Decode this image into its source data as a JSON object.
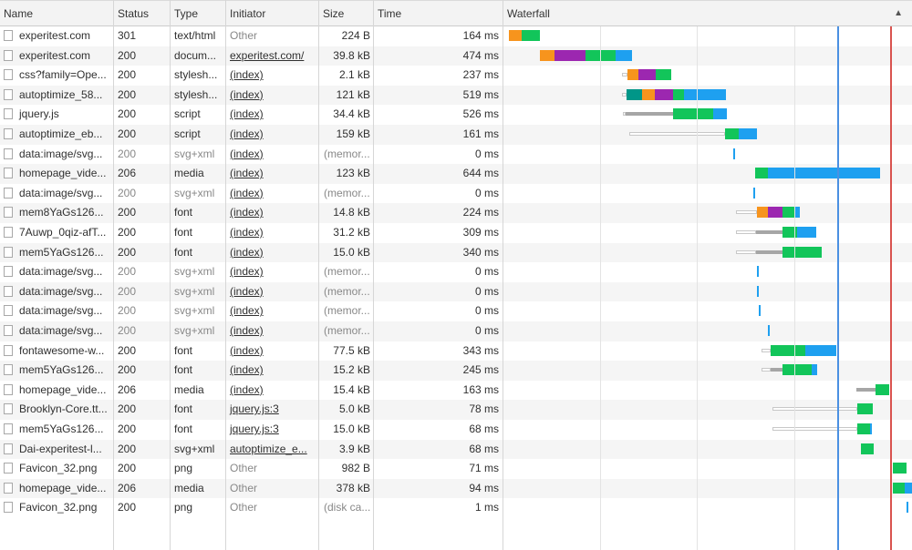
{
  "columns": {
    "name": "Name",
    "status": "Status",
    "type": "Type",
    "initiator": "Initiator",
    "size": "Size",
    "time": "Time",
    "waterfall": "Waterfall"
  },
  "sort_icon": "triangle-up-icon",
  "colors": {
    "dns": "#f7941d",
    "connect": "#9c27b0",
    "ssl": "#009688",
    "waiting": "#12c55a",
    "download": "#1ea0f0",
    "dom_content_loaded_line": "#4a90e2",
    "load_line": "#d9534f"
  },
  "rows": [
    {
      "name": "experitest.com",
      "status": "301",
      "type": "text/html",
      "initiator": "Other",
      "size": "224 B",
      "time": "164 ms"
    },
    {
      "name": "experitest.com",
      "status": "200",
      "type": "docum...",
      "initiator": "experitest.com/",
      "size": "39.8 kB",
      "time": "474 ms"
    },
    {
      "name": "css?family=Ope...",
      "status": "200",
      "type": "stylesh...",
      "initiator": "(index)",
      "size": "2.1 kB",
      "time": "237 ms"
    },
    {
      "name": "autoptimize_58...",
      "status": "200",
      "type": "stylesh...",
      "initiator": "(index)",
      "size": "121 kB",
      "time": "519 ms"
    },
    {
      "name": "jquery.js",
      "status": "200",
      "type": "script",
      "initiator": "(index)",
      "size": "34.4 kB",
      "time": "526 ms"
    },
    {
      "name": "autoptimize_eb...",
      "status": "200",
      "type": "script",
      "initiator": "(index)",
      "size": "159 kB",
      "time": "161 ms"
    },
    {
      "name": "data:image/svg...",
      "status": "200",
      "type": "svg+xml",
      "initiator": "(index)",
      "size": "(memor...",
      "time": "0 ms"
    },
    {
      "name": "homepage_vide...",
      "status": "206",
      "type": "media",
      "initiator": "(index)",
      "size": "123 kB",
      "time": "644 ms"
    },
    {
      "name": "data:image/svg...",
      "status": "200",
      "type": "svg+xml",
      "initiator": "(index)",
      "size": "(memor...",
      "time": "0 ms"
    },
    {
      "name": "mem8YaGs126...",
      "status": "200",
      "type": "font",
      "initiator": "(index)",
      "size": "14.8 kB",
      "time": "224 ms"
    },
    {
      "name": "7Auwp_0qiz-afT...",
      "status": "200",
      "type": "font",
      "initiator": "(index)",
      "size": "31.2 kB",
      "time": "309 ms"
    },
    {
      "name": "mem5YaGs126...",
      "status": "200",
      "type": "font",
      "initiator": "(index)",
      "size": "15.0 kB",
      "time": "340 ms"
    },
    {
      "name": "data:image/svg...",
      "status": "200",
      "type": "svg+xml",
      "initiator": "(index)",
      "size": "(memor...",
      "time": "0 ms"
    },
    {
      "name": "data:image/svg...",
      "status": "200",
      "type": "svg+xml",
      "initiator": "(index)",
      "size": "(memor...",
      "time": "0 ms"
    },
    {
      "name": "data:image/svg...",
      "status": "200",
      "type": "svg+xml",
      "initiator": "(index)",
      "size": "(memor...",
      "time": "0 ms"
    },
    {
      "name": "data:image/svg...",
      "status": "200",
      "type": "svg+xml",
      "initiator": "(index)",
      "size": "(memor...",
      "time": "0 ms"
    },
    {
      "name": "fontawesome-w...",
      "status": "200",
      "type": "font",
      "initiator": "(index)",
      "size": "77.5 kB",
      "time": "343 ms"
    },
    {
      "name": "mem5YaGs126...",
      "status": "200",
      "type": "font",
      "initiator": "(index)",
      "size": "15.2 kB",
      "time": "245 ms"
    },
    {
      "name": "homepage_vide...",
      "status": "206",
      "type": "media",
      "initiator": "(index)",
      "size": "15.4 kB",
      "time": "163 ms"
    },
    {
      "name": "Brooklyn-Core.tt...",
      "status": "200",
      "type": "font",
      "initiator": "jquery.js:3",
      "size": "5.0 kB",
      "time": "78 ms"
    },
    {
      "name": "mem5YaGs126...",
      "status": "200",
      "type": "font",
      "initiator": "jquery.js:3",
      "size": "15.0 kB",
      "time": "68 ms"
    },
    {
      "name": "Dai-experitest-l...",
      "status": "200",
      "type": "svg+xml",
      "initiator": "autoptimize_e...",
      "size": "3.9 kB",
      "time": "68 ms"
    },
    {
      "name": "Favicon_32.png",
      "status": "200",
      "type": "png",
      "initiator": "Other",
      "size": "982 B",
      "time": "71 ms"
    },
    {
      "name": "homepage_vide...",
      "status": "206",
      "type": "media",
      "initiator": "Other",
      "size": "378 kB",
      "time": "94 ms"
    },
    {
      "name": "Favicon_32.png",
      "status": "200",
      "type": "png",
      "initiator": "Other",
      "size": "(disk ca...",
      "time": "1 ms"
    }
  ]
}
